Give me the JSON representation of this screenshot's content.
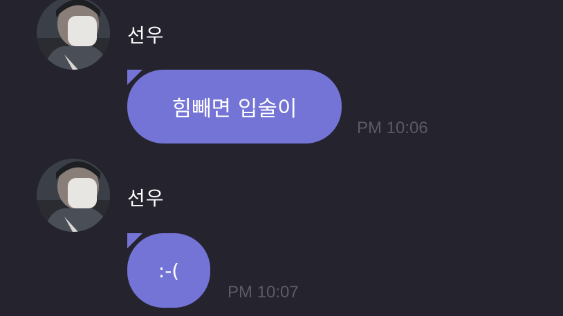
{
  "messages": [
    {
      "sender": "선우",
      "text": "힘빼면 입술이",
      "time": "PM 10:06",
      "avatar_icon": "profile-photo-masked-person"
    },
    {
      "sender": "선우",
      "text": ":-(",
      "time": "PM 10:07",
      "avatar_icon": "profile-photo-masked-person"
    }
  ],
  "colors": {
    "background": "#24232e",
    "bubble": "#7474d6",
    "time_text": "#5b5b67",
    "name_text": "#ffffff"
  }
}
